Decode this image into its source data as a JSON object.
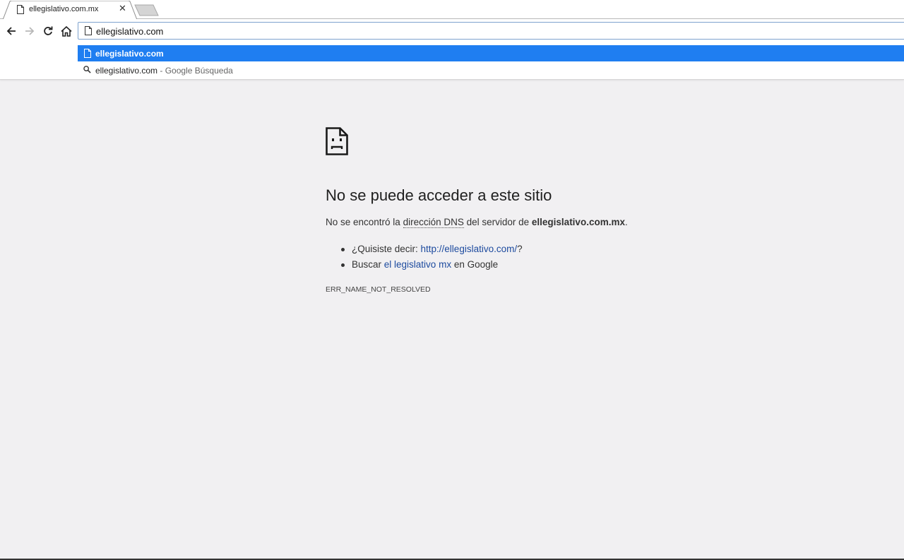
{
  "tab": {
    "title": "ellegislativo.com.mx",
    "close_glyph": "✕"
  },
  "omnibox": {
    "value": "ellegislativo.com"
  },
  "suggestions": [
    {
      "text": "ellegislativo.com",
      "suffix": ""
    },
    {
      "text": "ellegislativo.com",
      "suffix": " - Google Búsqueda"
    }
  ],
  "error": {
    "title": "No se puede acceder a este sitio",
    "desc_pre": "No se encontró la ",
    "desc_abbr": "dirección DNS",
    "desc_mid": " del servidor de ",
    "desc_host": "ellegislativo.com.mx",
    "desc_end": ".",
    "suggestion1_pre": "¿Quisiste decir: ",
    "suggestion1_link": "http://ellegislativo.com/",
    "suggestion1_post": "?",
    "suggestion2_pre": "Buscar ",
    "suggestion2_link": "el legislativo mx",
    "suggestion2_post": " en Google",
    "code": "ERR_NAME_NOT_RESOLVED"
  },
  "icons": {
    "tab_favicon": "page-icon",
    "back": "arrow-left-icon",
    "forward": "arrow-right-icon",
    "reload": "reload-icon",
    "home": "home-icon",
    "search": "search-icon",
    "error": "sad-page-icon"
  },
  "colors": {
    "selected_suggestion": "#1f7ef1",
    "link": "#1c4a9e",
    "page_background": "#f1f0f2"
  }
}
